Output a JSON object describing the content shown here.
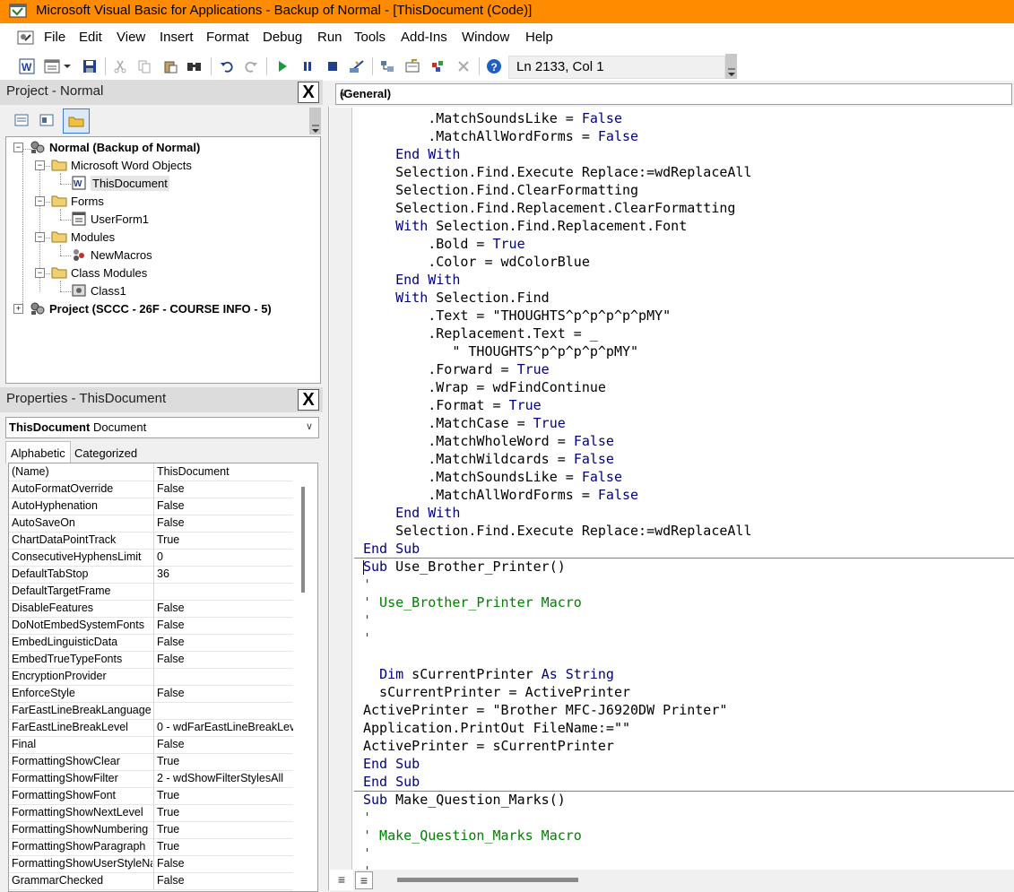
{
  "window": {
    "title": "Microsoft Visual Basic for Applications - Backup of Normal - [ThisDocument (Code)]",
    "accent_color": "#ff8c00"
  },
  "menu": {
    "items": [
      "File",
      "Edit",
      "View",
      "Insert",
      "Format",
      "Debug",
      "Run",
      "Tools",
      "Add-Ins",
      "Window",
      "Help"
    ]
  },
  "toolbar": {
    "position": "Ln 2133, Col 1",
    "icons": [
      "word-icon",
      "insert-userform-icon",
      "save-icon",
      "cut-icon",
      "copy-icon",
      "paste-icon",
      "find-icon",
      "undo-icon",
      "redo-icon",
      "run-icon",
      "break-icon",
      "reset-icon",
      "design-mode-icon",
      "project-explorer-icon",
      "properties-icon",
      "object-browser-icon",
      "toolbox-icon",
      "help-icon"
    ]
  },
  "project": {
    "title": "Project - Normal",
    "close": "X",
    "tree": [
      {
        "label": "Normal (Backup of Normal)",
        "level": 0,
        "bold": true,
        "icon": "vba-project-icon"
      },
      {
        "label": "Microsoft Word Objects",
        "level": 1,
        "bold": false,
        "icon": "folder-icon"
      },
      {
        "label": "ThisDocument",
        "level": 2,
        "bold": false,
        "icon": "word-document-icon",
        "selected": true
      },
      {
        "label": "Forms",
        "level": 1,
        "bold": false,
        "icon": "folder-icon"
      },
      {
        "label": "UserForm1",
        "level": 2,
        "bold": false,
        "icon": "userform-icon"
      },
      {
        "label": "Modules",
        "level": 1,
        "bold": false,
        "icon": "folder-icon"
      },
      {
        "label": "NewMacros",
        "level": 2,
        "bold": false,
        "icon": "module-icon"
      },
      {
        "label": "Class Modules",
        "level": 1,
        "bold": false,
        "icon": "folder-icon"
      },
      {
        "label": "Class1",
        "level": 2,
        "bold": false,
        "icon": "class-module-icon"
      },
      {
        "label": "Project (SCCC - 26F - COURSE INFO - 5)",
        "level": 0,
        "bold": true,
        "icon": "vba-project-icon"
      }
    ]
  },
  "properties": {
    "title": "Properties - ThisDocument",
    "close": "X",
    "object_name": "ThisDocument",
    "object_type": "Document",
    "tabs": [
      "Alphabetic",
      "Categorized"
    ],
    "rows": [
      {
        "name": "(Name)",
        "value": "ThisDocument"
      },
      {
        "name": "AutoFormatOverride",
        "value": "False"
      },
      {
        "name": "AutoHyphenation",
        "value": "False"
      },
      {
        "name": "AutoSaveOn",
        "value": "False"
      },
      {
        "name": "ChartDataPointTrack",
        "value": "True"
      },
      {
        "name": "ConsecutiveHyphensLimit",
        "value": "0"
      },
      {
        "name": "DefaultTabStop",
        "value": "36"
      },
      {
        "name": "DefaultTargetFrame",
        "value": ""
      },
      {
        "name": "DisableFeatures",
        "value": "False"
      },
      {
        "name": "DoNotEmbedSystemFonts",
        "value": "False"
      },
      {
        "name": "EmbedLinguisticData",
        "value": "False"
      },
      {
        "name": "EmbedTrueTypeFonts",
        "value": "False"
      },
      {
        "name": "EncryptionProvider",
        "value": ""
      },
      {
        "name": "EnforceStyle",
        "value": "False"
      },
      {
        "name": "FarEastLineBreakLanguage",
        "value": ""
      },
      {
        "name": "FarEastLineBreakLevel",
        "value": "0 - wdFarEastLineBreakLev"
      },
      {
        "name": "Final",
        "value": "False"
      },
      {
        "name": "FormattingShowClear",
        "value": "True"
      },
      {
        "name": "FormattingShowFilter",
        "value": "2 - wdShowFilterStylesAll"
      },
      {
        "name": "FormattingShowFont",
        "value": "True"
      },
      {
        "name": "FormattingShowNextLevel",
        "value": "True"
      },
      {
        "name": "FormattingShowNumbering",
        "value": "True"
      },
      {
        "name": "FormattingShowParagraph",
        "value": "True"
      },
      {
        "name": "FormattingShowUserStyleName",
        "value": "False"
      },
      {
        "name": "GrammarChecked",
        "value": "False"
      }
    ]
  },
  "code": {
    "object_dropdown": "(General)",
    "keyword_color": "#00007f",
    "comment_color": "#007f00",
    "lines": [
      {
        "t": "        .MatchSoundsLike = False"
      },
      {
        "t": "        .MatchAllWordForms = False"
      },
      {
        "t": "    End With"
      },
      {
        "t": "    Selection.Find.Execute Replace:=wdReplaceAll"
      },
      {
        "t": "    Selection.Find.ClearFormatting"
      },
      {
        "t": "    Selection.Find.Replacement.ClearFormatting"
      },
      {
        "t": "    With Selection.Find.Replacement.Font"
      },
      {
        "t": "        .Bold = True"
      },
      {
        "t": "        .Color = wdColorBlue"
      },
      {
        "t": "    End With"
      },
      {
        "t": "    With Selection.Find"
      },
      {
        "t": "        .Text = \"THOUGHTS^p^p^p^p^pMY\""
      },
      {
        "t": "        .Replacement.Text = _"
      },
      {
        "t": "           \" THOUGHTS^p^p^p^p^pMY\""
      },
      {
        "t": "        .Forward = True"
      },
      {
        "t": "        .Wrap = wdFindContinue"
      },
      {
        "t": "        .Format = True"
      },
      {
        "t": "        .MatchCase = True"
      },
      {
        "t": "        .MatchWholeWord = False"
      },
      {
        "t": "        .MatchWildcards = False"
      },
      {
        "t": "        .MatchSoundsLike = False"
      },
      {
        "t": "        .MatchAllWordForms = False"
      },
      {
        "t": "    End With"
      },
      {
        "t": "    Selection.Find.Execute Replace:=wdReplaceAll"
      },
      {
        "t": "End Sub",
        "sepAfter": true
      },
      {
        "t": "Sub Use_Brother_Printer()"
      },
      {
        "t": "'",
        "c": true
      },
      {
        "t": "' Use_Brother_Printer Macro",
        "c": true
      },
      {
        "t": "'",
        "c": true
      },
      {
        "t": "'",
        "c": true
      },
      {
        "t": ""
      },
      {
        "t": "  Dim sCurrentPrinter As String"
      },
      {
        "t": "  sCurrentPrinter = ActivePrinter"
      },
      {
        "t": "ActivePrinter = \"Brother MFC-J6920DW Printer\""
      },
      {
        "t": "Application.PrintOut FileName:=\"\""
      },
      {
        "t": "ActivePrinter = sCurrentPrinter"
      },
      {
        "t": "End Sub"
      },
      {
        "t": "End Sub",
        "sepAfter": true
      },
      {
        "t": "Sub Make_Question_Marks()"
      },
      {
        "t": "'",
        "c": true
      },
      {
        "t": "' Make_Question_Marks Macro",
        "c": true
      },
      {
        "t": "'",
        "c": true
      },
      {
        "t": "'",
        "c": true
      }
    ]
  }
}
